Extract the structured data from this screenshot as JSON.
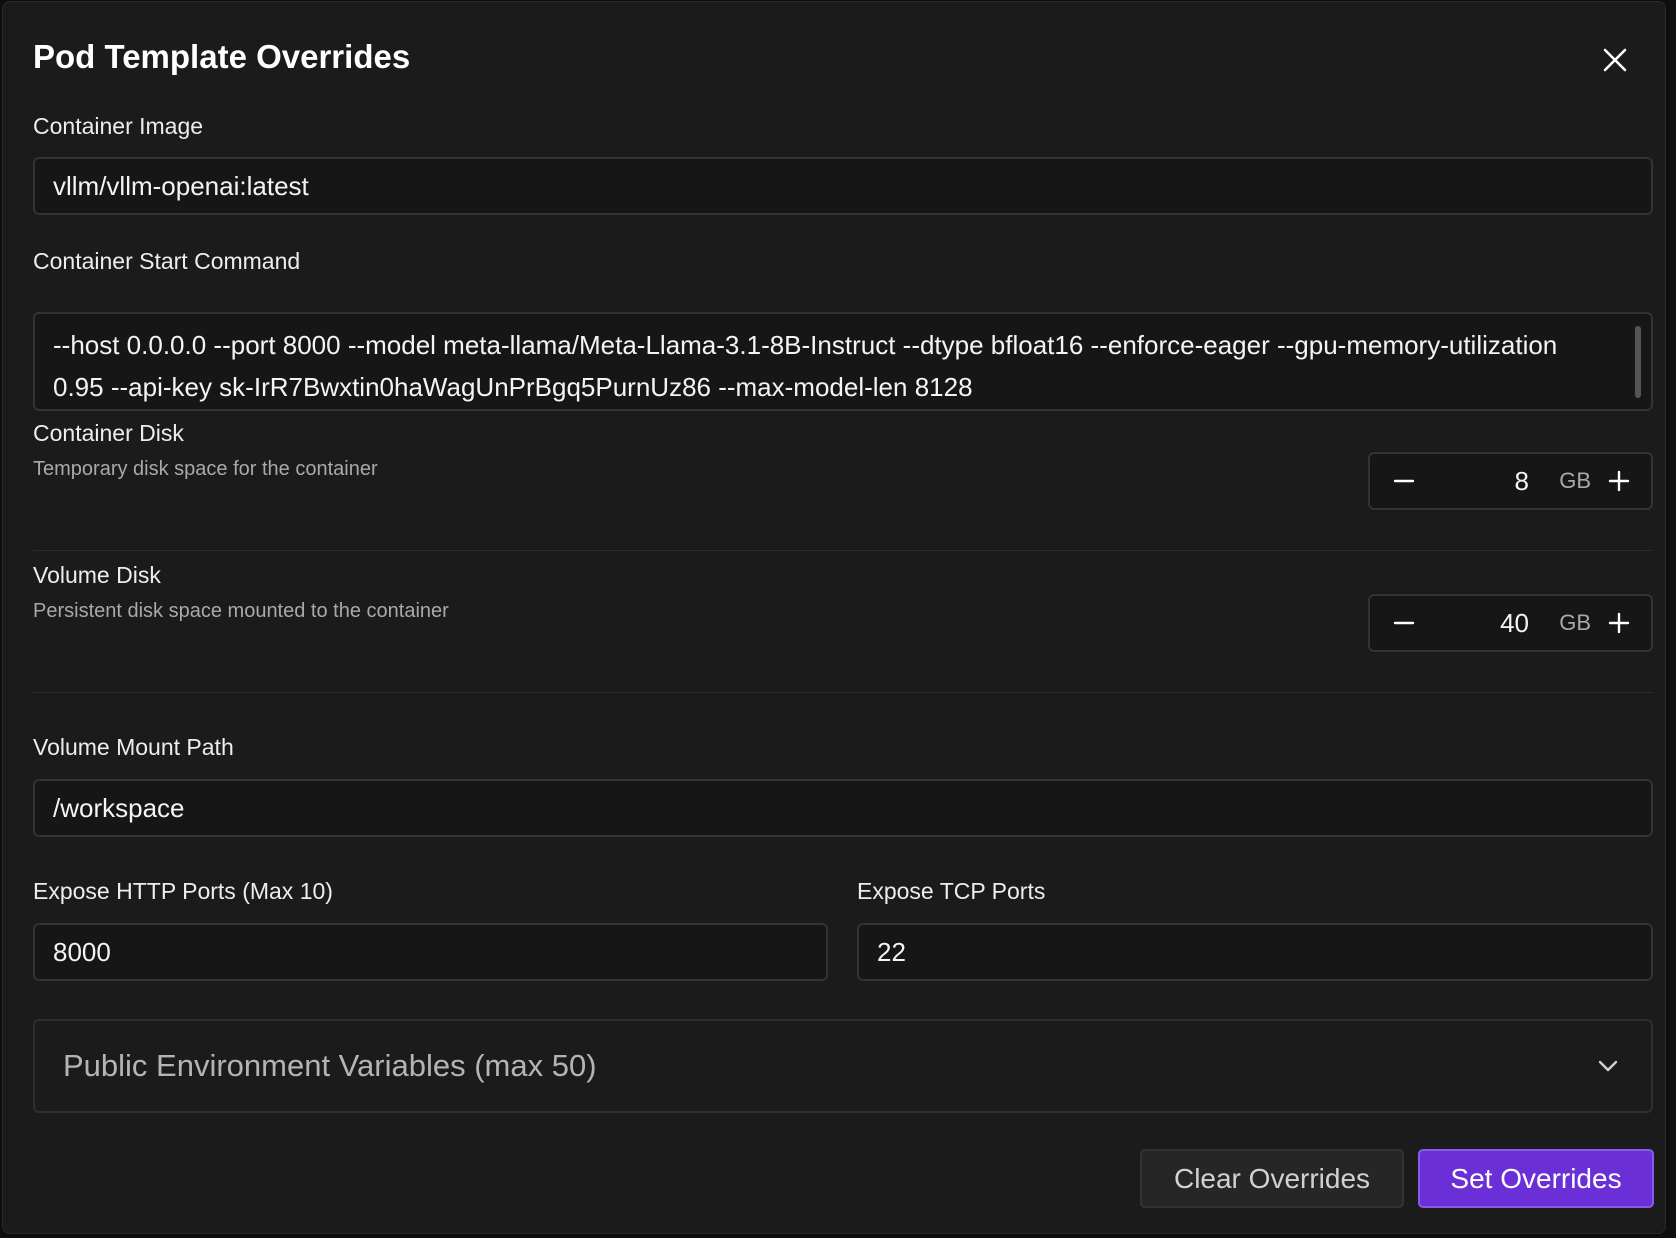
{
  "dialog": {
    "title": "Pod Template Overrides",
    "close_icon": "close-icon"
  },
  "container_image": {
    "label": "Container Image",
    "value": "vllm/vllm-openai:latest"
  },
  "start_command": {
    "label": "Container Start Command",
    "value": "--host 0.0.0.0 --port 8000 --model meta-llama/Meta-Llama-3.1-8B-Instruct --dtype bfloat16 --enforce-eager --gpu-memory-utilization 0.95 --api-key sk-IrR7Bwxtin0haWagUnPrBgq5PurnUz86 --max-model-len 8128"
  },
  "container_disk": {
    "label": "Container Disk",
    "description": "Temporary disk space for the container",
    "value": "8",
    "unit": "GB"
  },
  "volume_disk": {
    "label": "Volume Disk",
    "description": "Persistent disk space mounted to the container",
    "value": "40",
    "unit": "GB"
  },
  "volume_mount": {
    "label": "Volume Mount Path",
    "value": "/workspace"
  },
  "http_ports": {
    "label": "Expose HTTP Ports (Max 10)",
    "value": "8000"
  },
  "tcp_ports": {
    "label": "Expose TCP Ports",
    "value": "22"
  },
  "env_vars": {
    "label": "Public Environment Variables (max 50)",
    "icon": "chevron-down-icon"
  },
  "actions": {
    "clear_label": "Clear Overrides",
    "set_label": "Set Overrides"
  },
  "colors": {
    "primary": "#6a2fd6",
    "background": "#1b1b1b"
  }
}
